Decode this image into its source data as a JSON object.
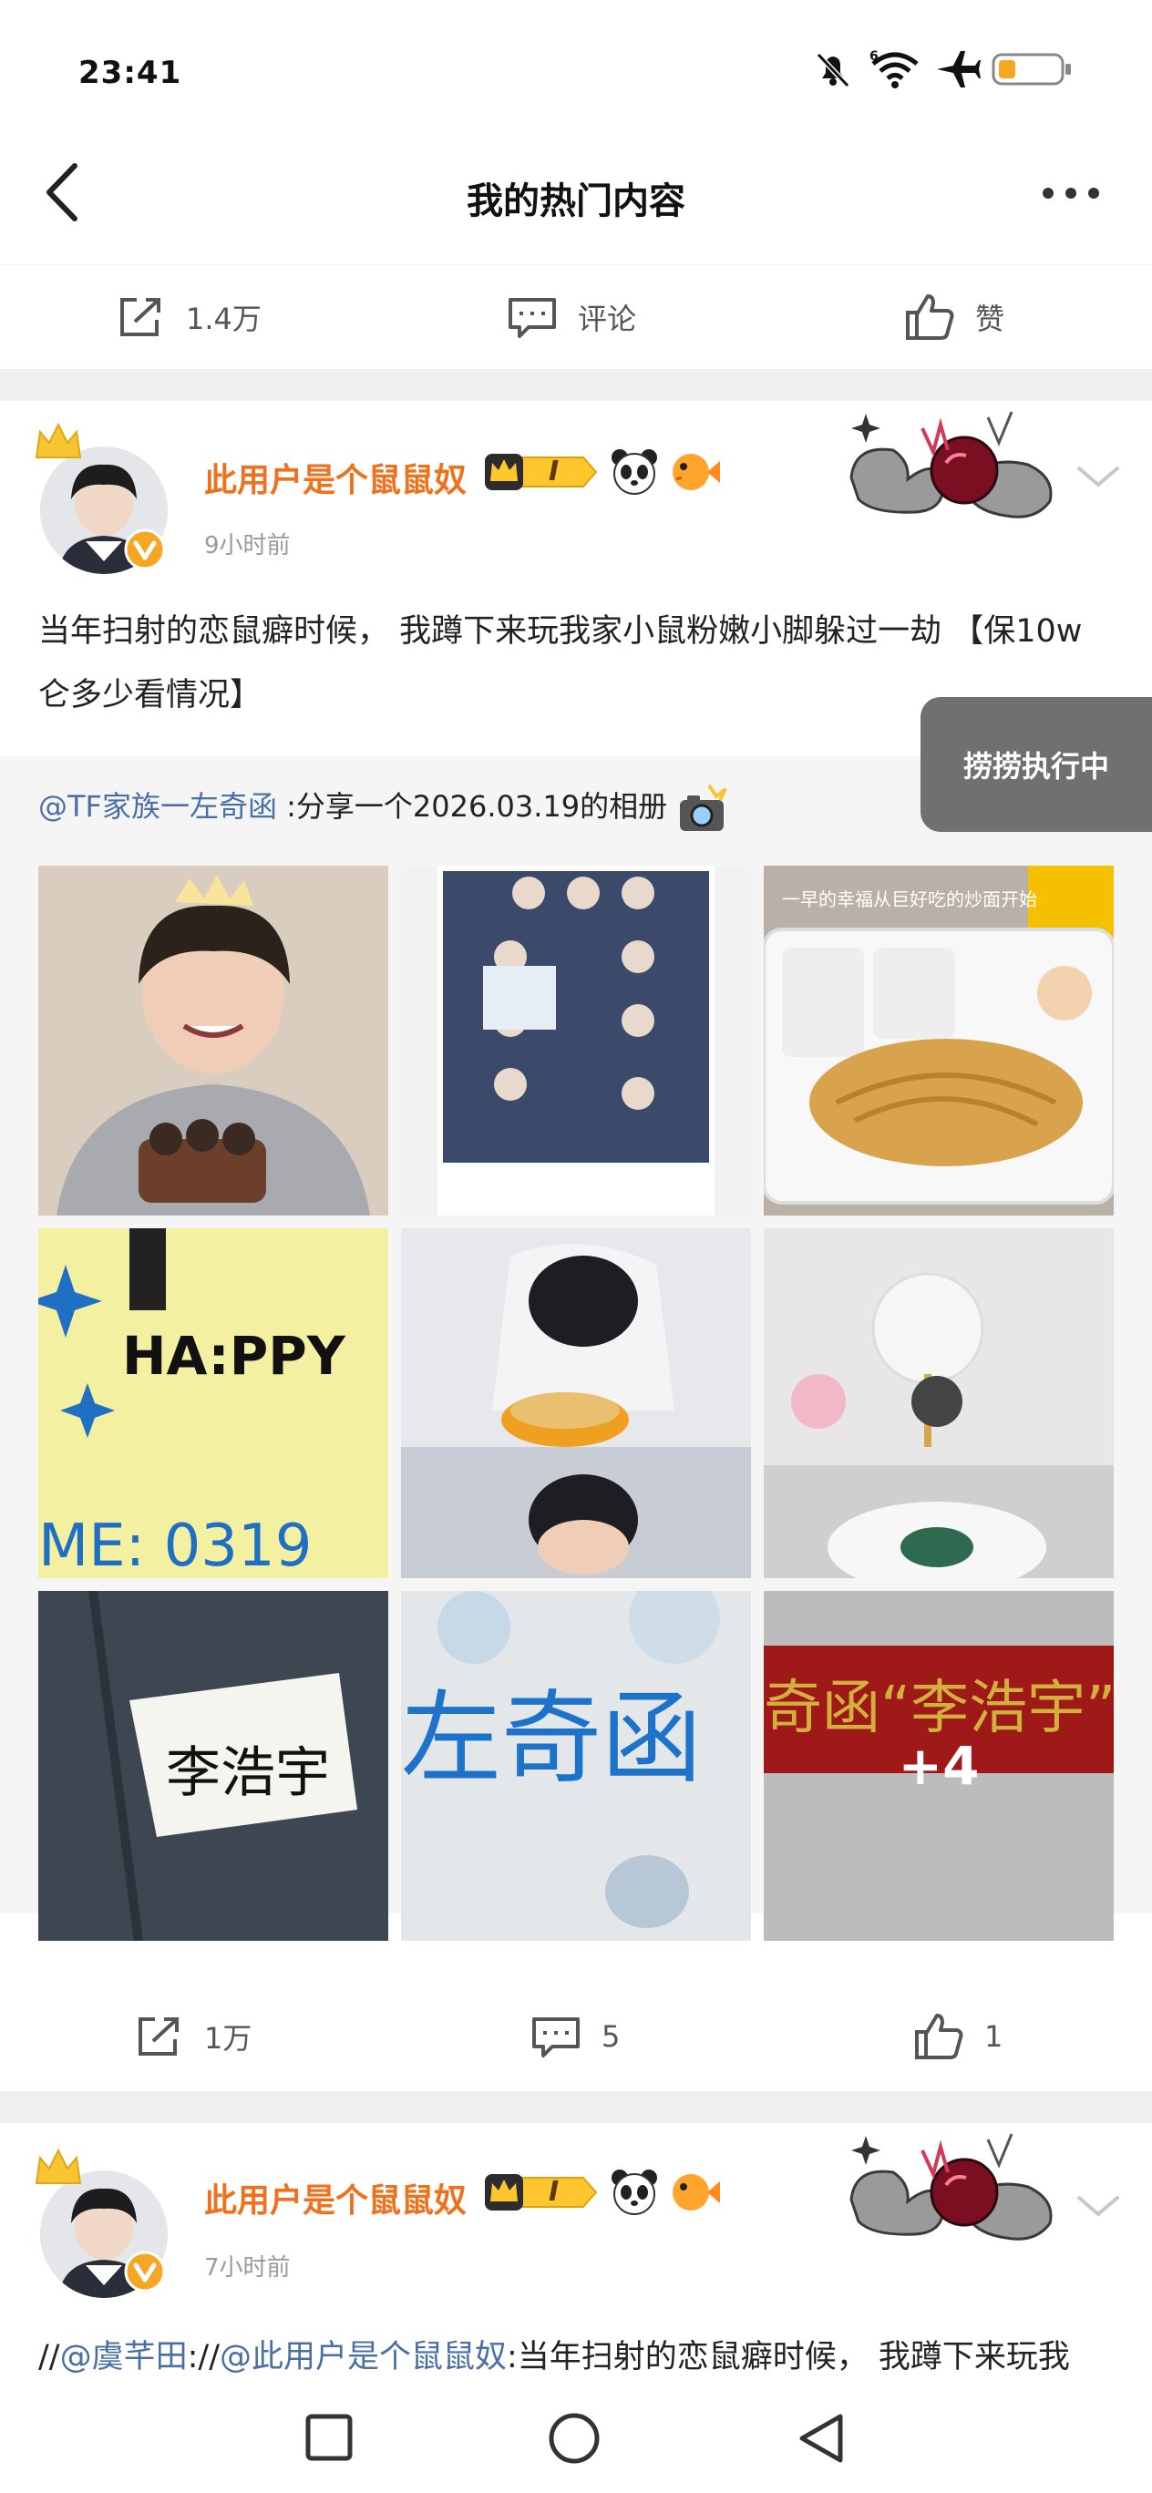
{
  "status_bar": {
    "time": "23:41",
    "icons": [
      "mute-bell-icon",
      "wifi-icon",
      "airplane-icon",
      "battery-low-icon"
    ]
  },
  "header": {
    "title": "我的热门内容",
    "back_icon": "chevron-left-icon",
    "more_icon": "more-dots-icon"
  },
  "top_actions": {
    "repost_count": "1.4万",
    "comment_label": "评论",
    "like_label": "赞"
  },
  "post1": {
    "username": "此用户是个鼠鼠奴",
    "level_badge": "I",
    "time": "9小时前",
    "text": "当年扫射的恋鼠癖时候， 我蹲下来玩我家小鼠粉嫩小脚躲过一劫 【保10w仑多少看情况】",
    "repost_author": "@TF家族一左奇函",
    "repost_text": " :分享一个2026.03.19的相册",
    "images_more": "+4",
    "actions": {
      "repost_count": "1万",
      "comment_count": "5",
      "like_count": "1"
    }
  },
  "floating_button": {
    "label": "捞捞执行中"
  },
  "post2": {
    "username": "此用户是个鼠鼠奴",
    "level_badge": "I",
    "time": "7小时前",
    "text_prefix": "//",
    "mention1": "@虞芊田",
    "text_mid": "://",
    "mention2": "@此用户是个鼠鼠奴",
    "text_suffix": ":当年扫射的恋鼠癖时候， 我蹲下来玩我"
  },
  "colors": {
    "username": "#f0701c",
    "link": "#4a6fa5",
    "band": "#efefef",
    "float_btn": "#707070"
  }
}
